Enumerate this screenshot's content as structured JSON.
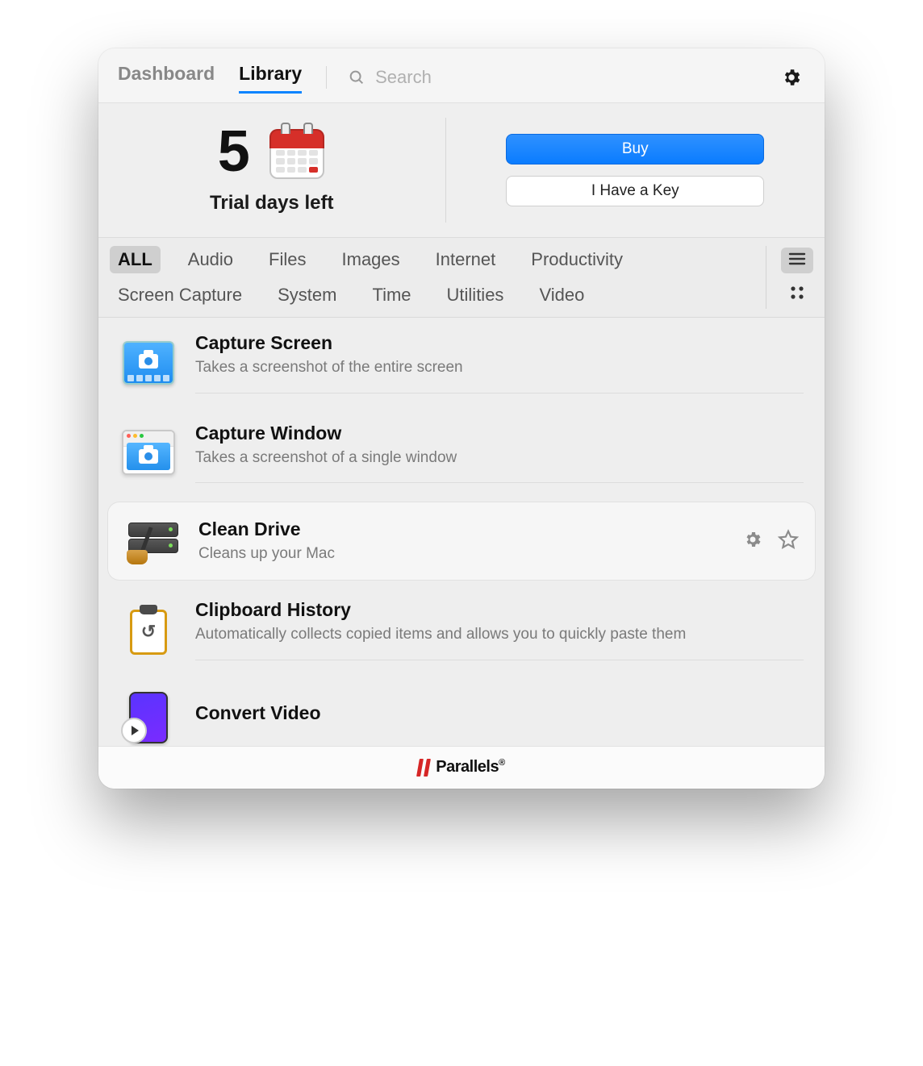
{
  "topbar": {
    "tabs": {
      "dashboard": "Dashboard",
      "library": "Library"
    },
    "active_tab": "library",
    "search_placeholder": "Search"
  },
  "trial": {
    "days_left_number": "5",
    "caption": "Trial days left",
    "buy_label": "Buy",
    "key_label": "I Have a Key"
  },
  "filters": {
    "categories": [
      "ALL",
      "Audio",
      "Files",
      "Images",
      "Internet",
      "Productivity",
      "Screen Capture",
      "System",
      "Time",
      "Utilities",
      "Video"
    ],
    "active_category": "ALL"
  },
  "tools": [
    {
      "id": "capture-screen",
      "title": "Capture Screen",
      "desc": "Takes a screenshot of the entire screen"
    },
    {
      "id": "capture-window",
      "title": "Capture Window",
      "desc": "Takes a screenshot of a single window"
    },
    {
      "id": "clean-drive",
      "title": "Clean Drive",
      "desc": "Cleans up your Mac",
      "hover": true
    },
    {
      "id": "clipboard-history",
      "title": "Clipboard History",
      "desc": "Automatically collects copied items and allows you to quickly paste them"
    },
    {
      "id": "convert-video",
      "title": "Convert Video",
      "desc": ""
    }
  ],
  "footer": {
    "brand": "Parallels"
  }
}
